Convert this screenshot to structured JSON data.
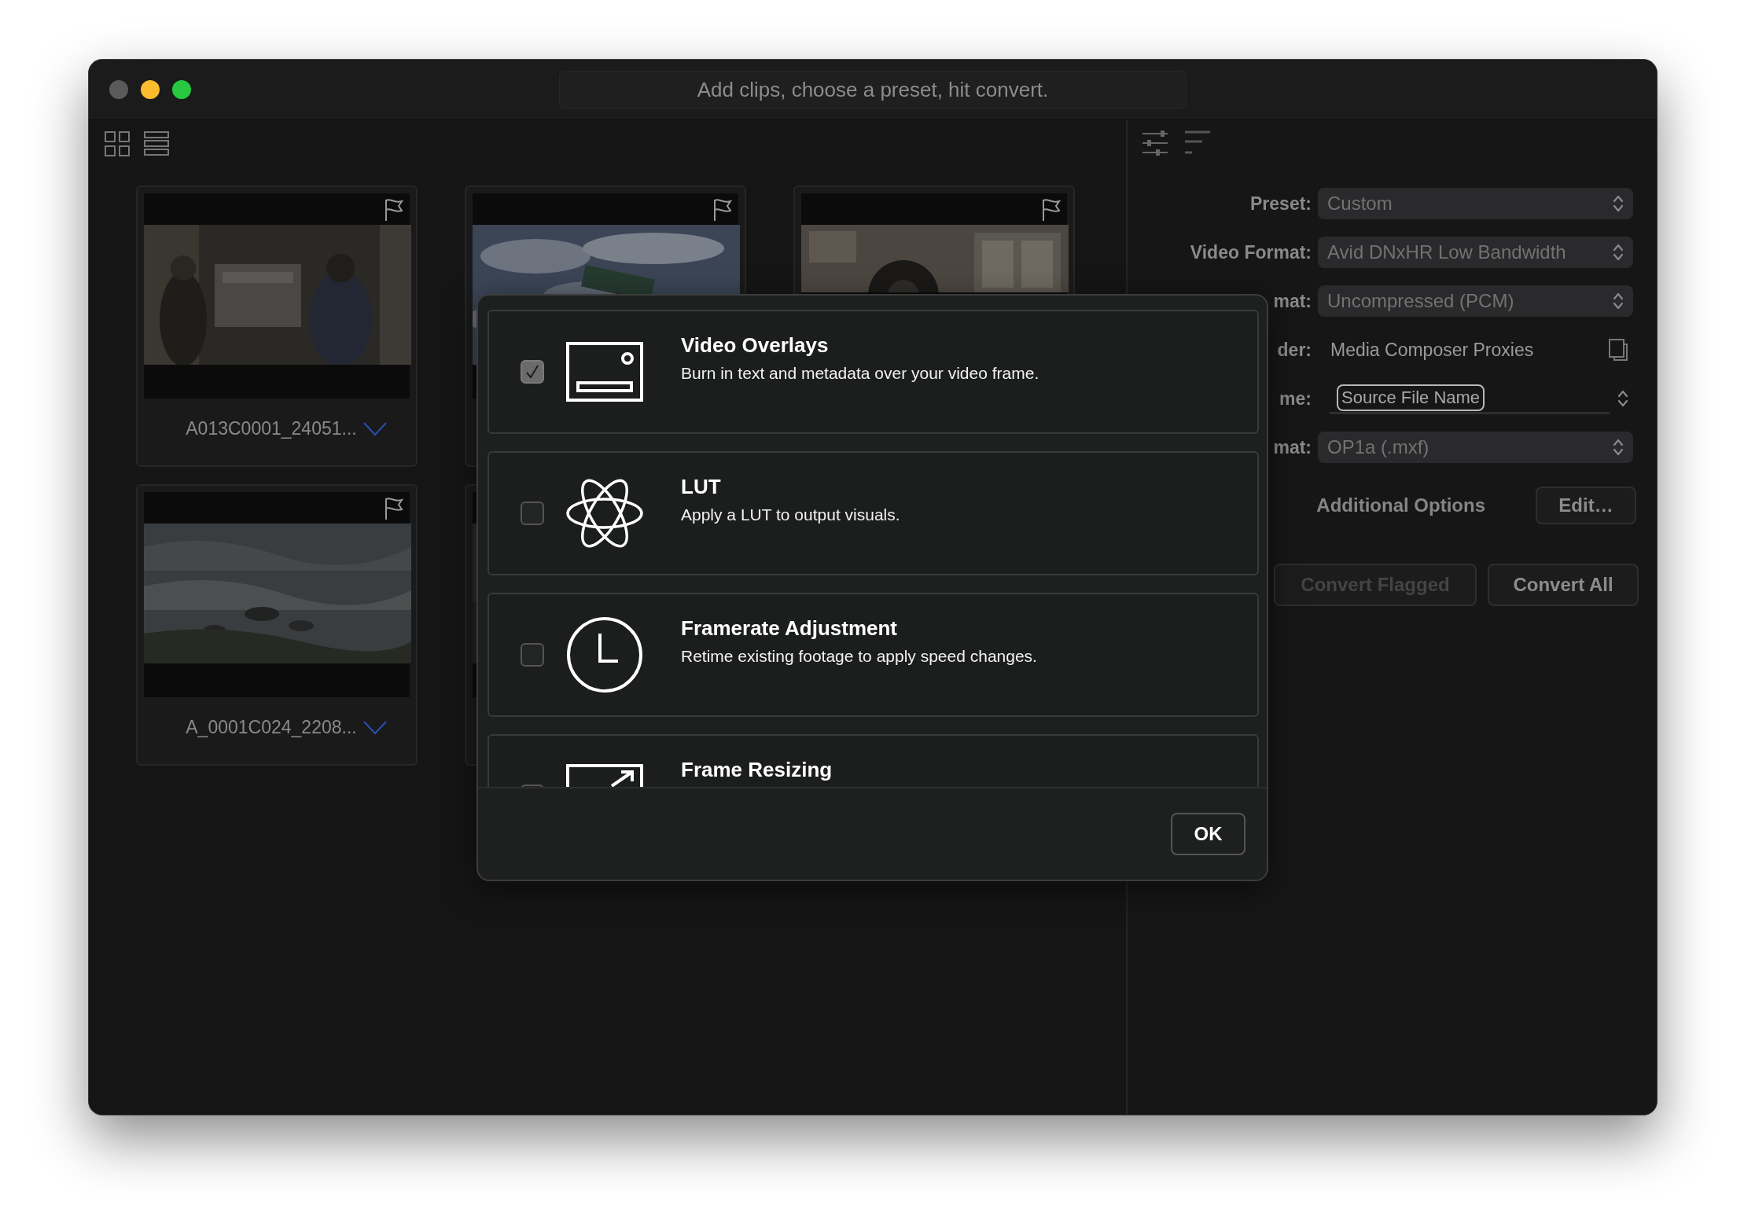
{
  "window": {
    "title": "Add clips, choose a preset, hit convert."
  },
  "clips": [
    {
      "kind": "picture",
      "name": "A013C0001_24051..."
    },
    {
      "kind": "picture"
    },
    {
      "kind": "picture"
    },
    {
      "kind": "picture",
      "name": "A_0001C024_2208..."
    },
    {
      "kind": "picture"
    }
  ],
  "settings": {
    "fields": [
      {
        "kind": "select",
        "label": "Preset:",
        "value": "Custom"
      },
      {
        "kind": "select",
        "label": "Video Format:",
        "value": "Avid DNxHR Low Bandwidth"
      },
      {
        "kind": "select",
        "label": "mat:",
        "value": "Uncompressed (PCM)"
      },
      {
        "kind": "folder",
        "label": "der:",
        "value": "Media Composer Proxies"
      },
      {
        "kind": "token",
        "label": "me:",
        "value": "Source File Name"
      },
      {
        "kind": "select",
        "label": "mat:",
        "value": "OP1a (.mxf)"
      }
    ],
    "additional_options": {
      "label": "Additional Options",
      "button": "Edit…"
    },
    "buttons": [
      {
        "label": "Convert Flagged",
        "disabled": true
      },
      {
        "label": "Convert All",
        "disabled": false
      }
    ]
  },
  "dialog": {
    "options": [
      {
        "kind": "overlay",
        "title": "Video Overlays",
        "description": "Burn in text and metadata over your video frame.",
        "checked": true
      },
      {
        "kind": "lut",
        "title": "LUT",
        "description": "Apply a LUT to output visuals.",
        "checked": false
      },
      {
        "kind": "clock",
        "title": "Framerate Adjustment",
        "description": "Retime existing footage to apply speed changes.",
        "checked": false
      },
      {
        "kind": "resize",
        "title": "Frame Resizing",
        "checked": false
      }
    ],
    "button": "OK"
  }
}
